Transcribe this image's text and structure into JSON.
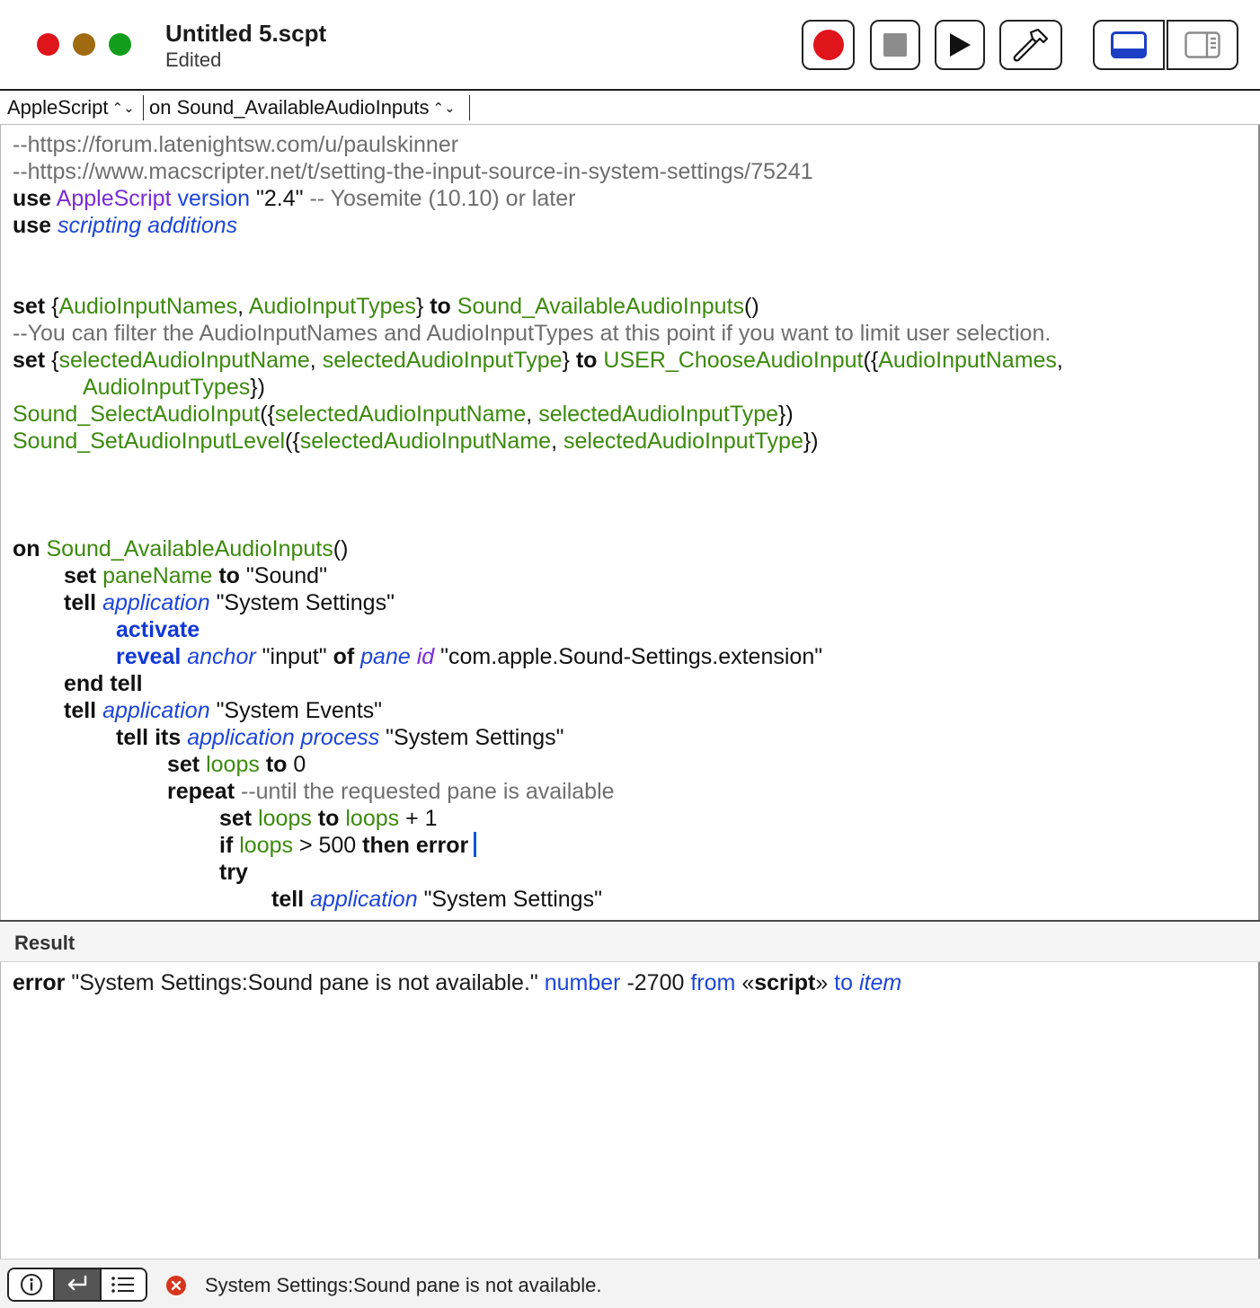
{
  "window": {
    "title": "Untitled 5.scpt",
    "subtitle": "Edited",
    "colors": {
      "close": "#e0141b",
      "minimize": "#a06a10",
      "zoom": "#129d1d"
    }
  },
  "toolbar": {
    "buttons": [
      {
        "name": "record",
        "icon": "record-icon"
      },
      {
        "name": "stop",
        "icon": "stop-icon"
      },
      {
        "name": "run",
        "icon": "play-icon"
      },
      {
        "name": "compile",
        "icon": "hammer-icon"
      },
      {
        "name": "show-log",
        "icon": "bottom-panel-icon"
      },
      {
        "name": "show-sidebar",
        "icon": "sidebar-icon"
      }
    ]
  },
  "navbar": {
    "language": "AppleScript",
    "handler": "on Sound_AvailableAudioInputs"
  },
  "code": {
    "l1": "--https://forum.latenightsw.com/u/paulskinner",
    "l2": "--https://www.macscripter.net/t/setting-the-input-source-in-system-settings/75241",
    "l3": {
      "kw": "use",
      "lang": "AppleScript",
      "prop": "version",
      "str": "\"2.4\"",
      "cmt": "-- Yosemite (10.10) or later"
    },
    "l4": {
      "kw": "use",
      "cls": "scripting additions"
    },
    "l7": {
      "kw": "set",
      "v1": "AudioInputNames",
      "v2": "AudioInputTypes",
      "to": "to",
      "h": "Sound_AvailableAudioInputs"
    },
    "l8": "--You can filter the AudioInputNames and AudioInputTypes at this point if you want to limit user selection.",
    "l9": {
      "kw": "set",
      "v1": "selectedAudioInputName",
      "v2": "selectedAudioInputType",
      "to": "to",
      "h": "USER_ChooseAudioInput",
      "a1": "AudioInputNames"
    },
    "l10": {
      "a2": "AudioInputTypes"
    },
    "l11": {
      "h": "Sound_SelectAudioInput",
      "v1": "selectedAudioInputName",
      "v2": "selectedAudioInputType"
    },
    "l12": {
      "h": "Sound_SetAudioInputLevel",
      "v1": "selectedAudioInputName",
      "v2": "selectedAudioInputType"
    },
    "l16": {
      "kw": "on",
      "h": "Sound_AvailableAudioInputs"
    },
    "l17": {
      "kw": "set",
      "v": "paneName",
      "to": "to",
      "str": "\"Sound\""
    },
    "l18": {
      "kw": "tell",
      "cls": "application",
      "str": "\"System Settings\""
    },
    "l19": {
      "cmd": "activate"
    },
    "l20": {
      "cmd": "reveal",
      "cls": "anchor",
      "str": "\"input\"",
      "of": "of",
      "cls2": "pane",
      "prop": "id",
      "str2": "\"com.apple.Sound-Settings.extension\""
    },
    "l21": {
      "kw": "end tell"
    },
    "l22": {
      "kw": "tell",
      "cls": "application",
      "str": "\"System Events\""
    },
    "l23": {
      "kw": "tell its",
      "cls": "application process",
      "str": "\"System Settings\""
    },
    "l24": {
      "kw": "set",
      "v": "loops",
      "to": "to",
      "num": "0"
    },
    "l25": {
      "kw": "repeat",
      "cmt": "--until the requested pane is available"
    },
    "l26": {
      "kw": "set",
      "v": "loops",
      "to": "to",
      "v2": "loops",
      "op": "+ 1"
    },
    "l27": {
      "kw": "if",
      "v": "loops",
      "op": "> 500",
      "kw2": "then error"
    },
    "l28": {
      "kw": "try"
    },
    "l29": {
      "kw": "tell",
      "cls": "application",
      "str": "\"System Settings\""
    }
  },
  "result": {
    "title": "Result",
    "error_kw": "error",
    "message": "\"System Settings:Sound pane is not available.\"",
    "number_label": "number",
    "number": "-2700",
    "from_label": "from",
    "from_open": "«",
    "from_obj": "script",
    "from_close": "»",
    "to_label": "to",
    "to_obj": "item"
  },
  "statusbar": {
    "segments": [
      {
        "name": "description",
        "icon": "info-icon"
      },
      {
        "name": "result",
        "icon": "return-arrow-icon",
        "active": true
      },
      {
        "name": "event-log",
        "icon": "list-icon"
      }
    ],
    "error_icon": "error-x-icon",
    "message": "System Settings:Sound pane is not available."
  }
}
